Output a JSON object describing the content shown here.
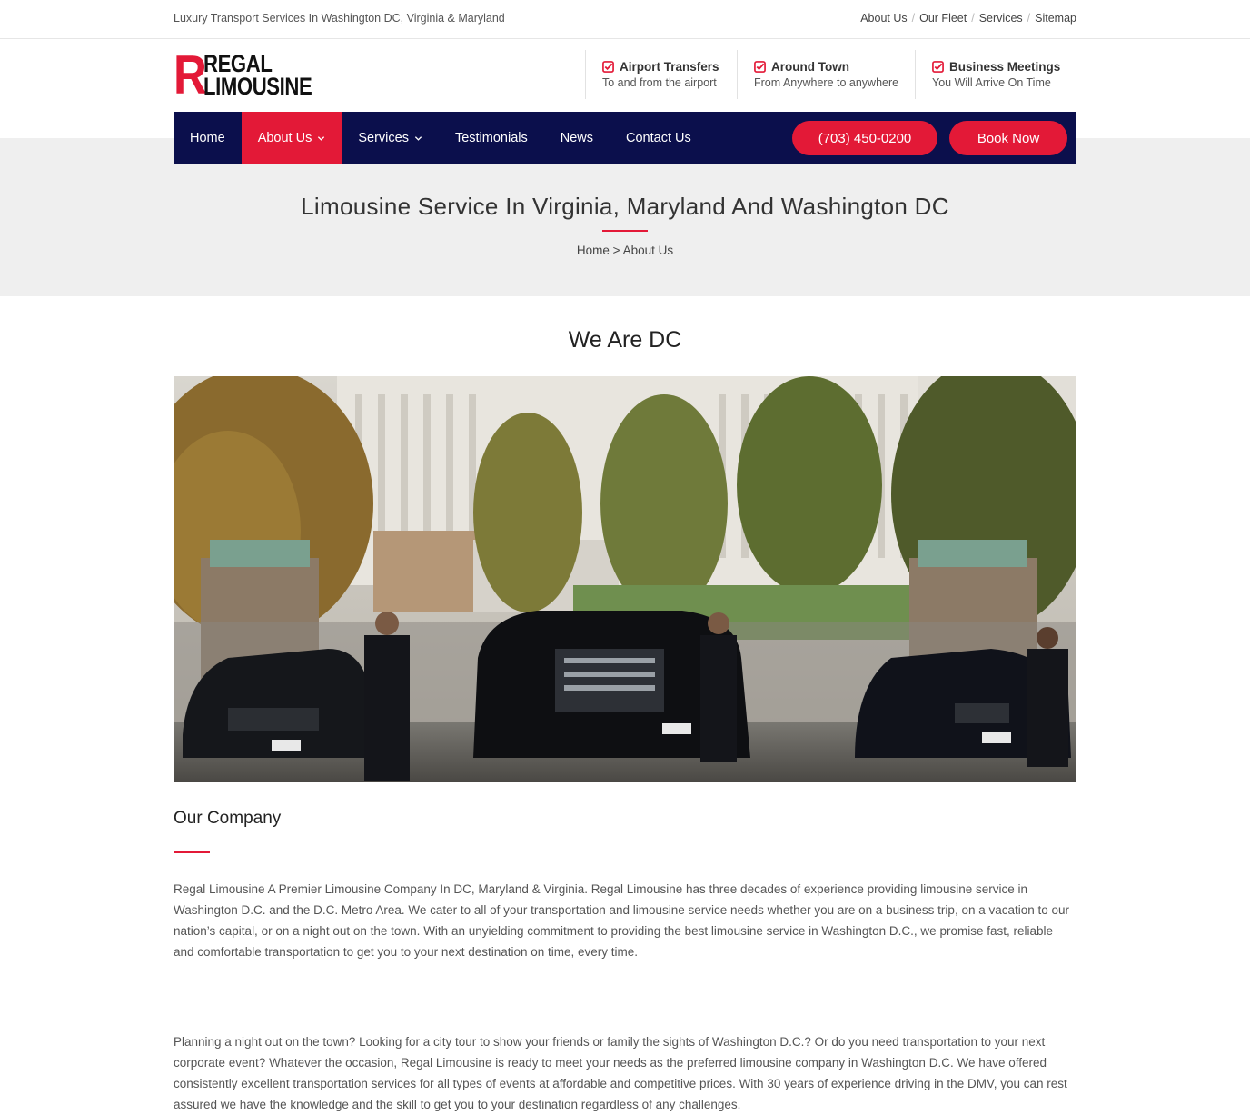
{
  "topbar": {
    "tagline": "Luxury Transport Services In Washington DC, Virginia & Maryland",
    "links": [
      "About Us",
      "Our Fleet",
      "Services",
      "Sitemap"
    ]
  },
  "logo": {
    "letter": "R",
    "line1": "REGAL",
    "line2": "LIMOUSINE"
  },
  "features": [
    {
      "title": "Airport Transfers",
      "sub": "To and from the airport",
      "icon": "check-square-icon"
    },
    {
      "title": "Around Town",
      "sub": "From Anywhere to anywhere",
      "icon": "check-square-icon"
    },
    {
      "title": "Business Meetings",
      "sub": "You Will Arrive On Time",
      "icon": "check-square-icon"
    }
  ],
  "nav": {
    "items": [
      {
        "label": "Home",
        "active": false,
        "dropdown": false
      },
      {
        "label": "About Us",
        "active": true,
        "dropdown": true
      },
      {
        "label": "Services",
        "active": false,
        "dropdown": true
      },
      {
        "label": "Testimonials",
        "active": false,
        "dropdown": false
      },
      {
        "label": "News",
        "active": false,
        "dropdown": false
      },
      {
        "label": "Contact Us",
        "active": false,
        "dropdown": false
      }
    ],
    "phone": "(703) 450-0200",
    "book": "Book Now"
  },
  "hero": {
    "title": "Limousine Service In Virginia, Maryland And Washington DC",
    "breadcrumb": {
      "home": "Home",
      "sep": ">",
      "current": "About Us"
    }
  },
  "section": {
    "title": "We Are DC"
  },
  "company": {
    "title": "Our Company",
    "p1": "Regal Limousine A Premier Limousine Company In DC, Maryland & Virginia. Regal Limousine has three decades of experience providing limousine service in Washington D.C. and the D.C. Metro Area. We cater to all of your transportation and limousine service needs whether you are on a business trip, on a vacation to our nation’s capital, or on a night out on the town. With an unyielding commitment to providing the best limousine service in Washington D.C., we promise fast, reliable and comfortable transportation to get you to your next destination on time, every time.",
    "p2": "Planning a night out on the town? Looking for a city tour to show your friends or family the sights of Washington D.C.? Or do you need transportation to your next corporate event? Whatever the occasion, Regal Limousine is ready to meet your needs as the preferred limousine company in Washington D.C. We have offered consistently excellent transportation services for all types of events at affordable and competitive prices. With 30 years of experience driving in the DMV, you can rest assured we have the knowledge and the skill to get you to your destination regardless of any challenges."
  },
  "colors": {
    "accent": "#e31937",
    "navy": "#0b0f4c",
    "hero_bg": "#efefef"
  }
}
